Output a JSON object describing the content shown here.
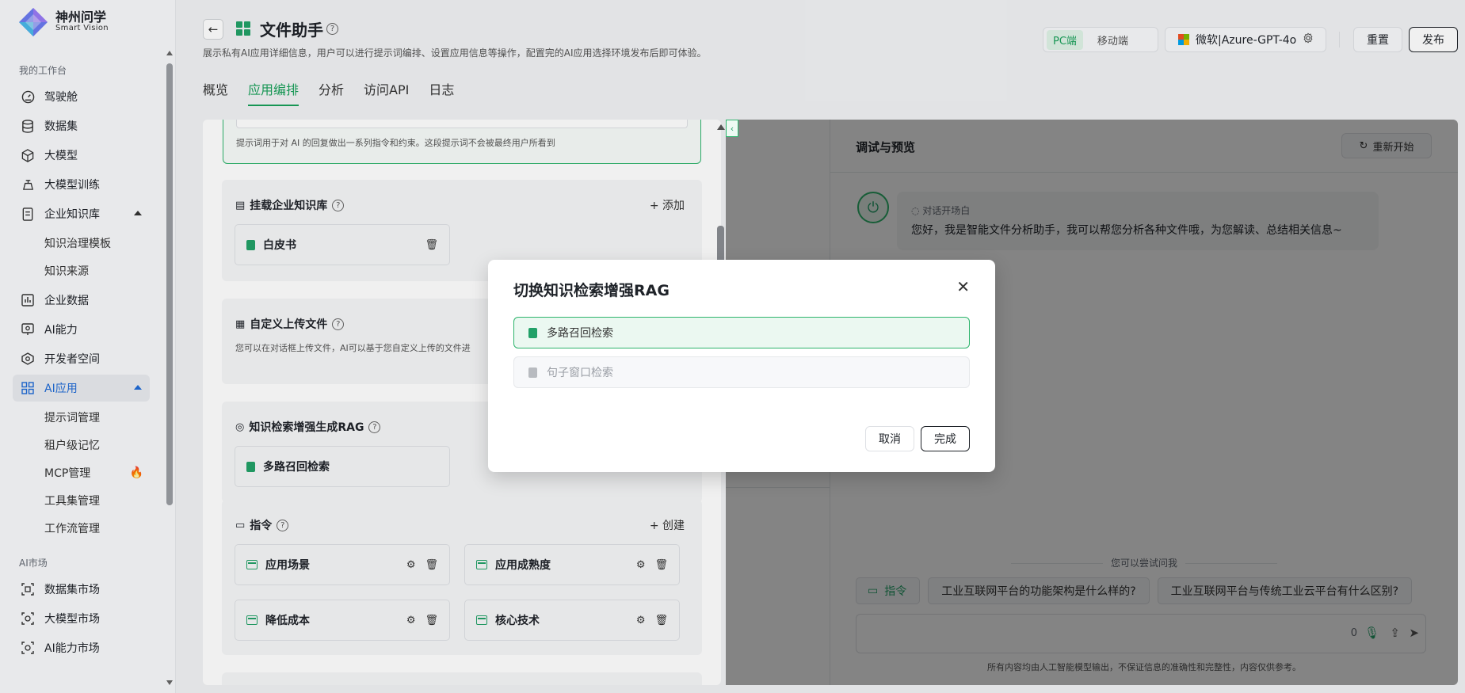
{
  "brand": {
    "name": "神州问学",
    "sub": "Smart Vision"
  },
  "sidebar": {
    "section_workspace": "我的工作台",
    "items": [
      {
        "label": "驾驶舱",
        "icon": "dashboard-icon"
      },
      {
        "label": "数据集",
        "icon": "database-icon"
      },
      {
        "label": "大模型",
        "icon": "cube-icon"
      },
      {
        "label": "大模型训练",
        "icon": "training-icon"
      },
      {
        "label": "企业知识库",
        "icon": "knowledge-icon"
      },
      {
        "label": "企业数据",
        "icon": "chart-icon"
      },
      {
        "label": "AI能力",
        "icon": "ai-ability-icon"
      },
      {
        "label": "开发者空间",
        "icon": "developer-icon"
      },
      {
        "label": "AI应用",
        "icon": "grid-icon"
      }
    ],
    "kb_sub": [
      "知识治理模板",
      "知识来源"
    ],
    "app_sub": [
      "提示词管理",
      "租户级记忆",
      "MCP管理",
      "工具集管理",
      "工作流管理"
    ],
    "section_market": "AI市场",
    "market": [
      "数据集市场",
      "大模型市场",
      "AI能力市场"
    ]
  },
  "header": {
    "back": "←",
    "title": "文件助手",
    "desc": "展示私有AI应用详细信息，用户可以进行提示词编排、设置应用信息等操作，配置完的AI应用选择环境发布后即可体验。",
    "tabs": [
      "概览",
      "应用编排",
      "分析",
      "访问API",
      "日志"
    ],
    "platform": [
      "PC端",
      "移动端"
    ],
    "model": "微软|Azure-GPT-4o",
    "reset": "重置",
    "publish": "发布"
  },
  "config": {
    "prompt_hint": "提示词用于对 AI 的回复做出一系列指令和约束。这段提示词不会被最终用户所看到",
    "kb": {
      "title": "挂载企业知识库",
      "action": "+ 添加",
      "item": "白皮书"
    },
    "upload": {
      "title": "自定义上传文件",
      "desc": "您可以在对话框上传文件，AI可以基于您自定义上传的文件进"
    },
    "rag": {
      "title": "知识检索增强生成RAG",
      "item": "多路召回检索"
    },
    "commands": {
      "title": "指令",
      "action": "+ 创建",
      "items": [
        "应用场景",
        "应用成熟度",
        "降低成本",
        "核心技术"
      ]
    }
  },
  "preview": {
    "title": "调试与预览",
    "restart": "重新开始",
    "opening_label": "对话开场白",
    "opening_msg": "您好，我是智能文件分析助手，我可以帮您分析各种文件哦，为您解读、总结相关信息~",
    "try_label": "您可以尝试问我",
    "cmd_chip": "指令",
    "suggestions": [
      "工业互联网平台的功能架构是什么样的?",
      "工业互联网平台与传统工业云平台有什么区别?"
    ],
    "count": "0",
    "disclaimer": "所有内容均由人工智能模型输出，不保证信息的准确性和完整性，内容仅供参考。"
  },
  "modal": {
    "title": "切换知识检索增强RAG",
    "options": [
      "多路召回检索",
      "句子窗口检索"
    ],
    "cancel": "取消",
    "done": "完成"
  }
}
